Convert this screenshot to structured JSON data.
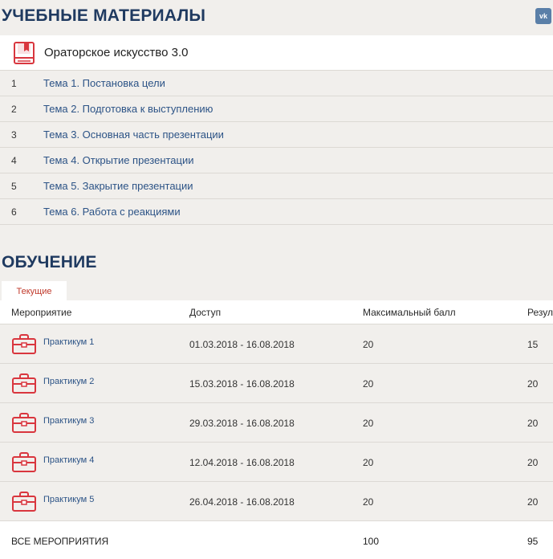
{
  "materials": {
    "section_title": "УЧЕБНЫЕ МАТЕРИАЛЫ",
    "vk_label": "vk",
    "course": {
      "icon": "book-icon",
      "title": "Ораторское искусство 3.0"
    },
    "topics": [
      {
        "num": "1",
        "title": "Тема 1. Постановка цели"
      },
      {
        "num": "2",
        "title": "Тема 2. Подготовка к выступлению"
      },
      {
        "num": "3",
        "title": "Тема 3. Основная часть презентации"
      },
      {
        "num": "4",
        "title": "Тема 4. Открытие презентации"
      },
      {
        "num": "5",
        "title": "Тема 5. Закрытие презентации"
      },
      {
        "num": "6",
        "title": "Тема 6. Работа с реакциями"
      }
    ]
  },
  "learning": {
    "section_title": "ОБУЧЕНИЕ",
    "tab_label": "Текущие",
    "columns": {
      "event": "Мероприятие",
      "access": "Доступ",
      "max_score": "Максимальный балл",
      "result": "Резуль"
    },
    "rows": [
      {
        "icon": "briefcase-icon",
        "name": "Практикум 1",
        "access": "01.03.2018 - 16.08.2018",
        "max": "20",
        "result": "15"
      },
      {
        "icon": "briefcase-icon",
        "name": "Практикум 2",
        "access": "15.03.2018 - 16.08.2018",
        "max": "20",
        "result": "20"
      },
      {
        "icon": "briefcase-icon",
        "name": "Практикум 3",
        "access": "29.03.2018 - 16.08.2018",
        "max": "20",
        "result": "20"
      },
      {
        "icon": "briefcase-icon",
        "name": "Практикум 4",
        "access": "12.04.2018 - 16.08.2018",
        "max": "20",
        "result": "20"
      },
      {
        "icon": "briefcase-icon",
        "name": "Практикум 5",
        "access": "26.04.2018 - 16.08.2018",
        "max": "20",
        "result": "20"
      }
    ],
    "footer": {
      "label": "ВСЕ МЕРОПРИЯТИЯ",
      "max_total": "100",
      "result_total": "95"
    }
  },
  "colors": {
    "background": "#f1efec",
    "heading": "#1f3a60",
    "link": "#2c5386",
    "accent_red": "#d9363e"
  }
}
